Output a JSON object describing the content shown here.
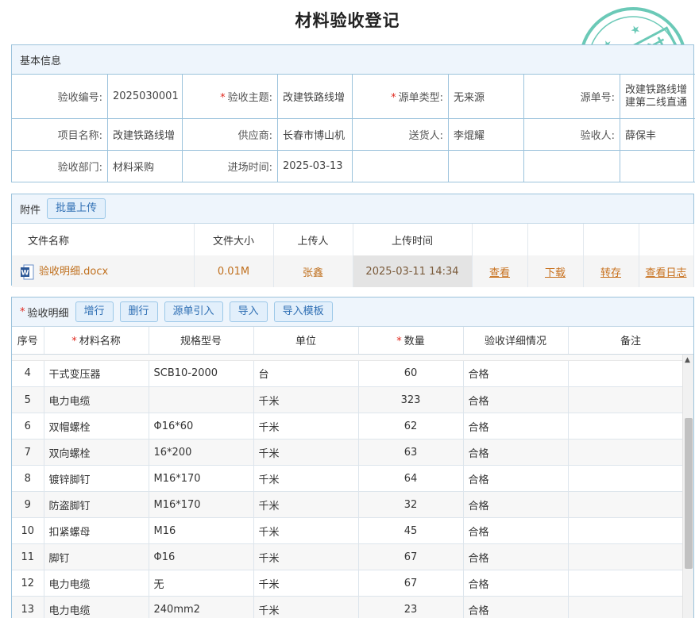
{
  "title": "材料验收登记",
  "stamp_text": "审核通过",
  "colors": {
    "accent": "#2f6fb4",
    "border": "#9cc3dc",
    "link": "#c8701c",
    "required": "#e0281e",
    "stamp": "#3ab8a0"
  },
  "basic": {
    "header": "基本信息",
    "fields": {
      "receipt_no": {
        "label": "验收编号:",
        "value": "2025030001"
      },
      "subject": {
        "label": "验收主题:",
        "value": "改建铁路线增"
      },
      "source_type": {
        "label": "源单类型:",
        "value": "无来源"
      },
      "source_no": {
        "label": "源单号:",
        "value": "改建铁路线增建第二线直通"
      },
      "project": {
        "label": "项目名称:",
        "value": "改建铁路线增"
      },
      "supplier": {
        "label": "供应商:",
        "value": "长春市博山机"
      },
      "deliverer": {
        "label": "送货人:",
        "value": "李焜耀"
      },
      "inspector": {
        "label": "验收人:",
        "value": "薛保丰"
      },
      "department": {
        "label": "验收部门:",
        "value": "材料采购"
      },
      "entry_time": {
        "label": "进场时间:",
        "value": "2025-03-13"
      }
    }
  },
  "attachments": {
    "header": "附件",
    "upload_button": "批量上传",
    "columns": {
      "name": "文件名称",
      "size": "文件大小",
      "uploader": "上传人",
      "time": "上传时间"
    },
    "file": {
      "name": "验收明细.docx",
      "size": "0.01M",
      "uploader": "张鑫",
      "time": "2025-03-11 14:34",
      "icon": "word-file-icon",
      "actions": {
        "view": "查看",
        "download": "下载",
        "save": "转存",
        "log": "查看日志"
      }
    }
  },
  "details": {
    "header": "验收明细",
    "buttons": {
      "add_row": "增行",
      "delete_row": "删行",
      "import_source": "源单引入",
      "import": "导入",
      "import_template": "导入模板"
    },
    "columns": {
      "seq": "序号",
      "material": "材料名称",
      "spec": "规格型号",
      "unit": "单位",
      "qty": "数量",
      "detail": "验收详细情况",
      "remark": "备注"
    },
    "rows": [
      {
        "seq": "4",
        "material": "干式变压器",
        "spec": "SCB10-2000",
        "unit": "台",
        "qty": "60",
        "detail": "合格",
        "remark": ""
      },
      {
        "seq": "5",
        "material": "电力电缆",
        "spec": "",
        "unit": "千米",
        "qty": "323",
        "detail": "合格",
        "remark": ""
      },
      {
        "seq": "6",
        "material": "双帽螺栓",
        "spec": "Φ16*60",
        "unit": "千米",
        "qty": "62",
        "detail": "合格",
        "remark": ""
      },
      {
        "seq": "7",
        "material": "双向螺栓",
        "spec": "16*200",
        "unit": "千米",
        "qty": "63",
        "detail": "合格",
        "remark": ""
      },
      {
        "seq": "8",
        "material": "镀锌脚钉",
        "spec": "M16*170",
        "unit": "千米",
        "qty": "64",
        "detail": "合格",
        "remark": ""
      },
      {
        "seq": "9",
        "material": "防盗脚钉",
        "spec": "M16*170",
        "unit": "千米",
        "qty": "32",
        "detail": "合格",
        "remark": ""
      },
      {
        "seq": "10",
        "material": "扣紧螺母",
        "spec": "M16",
        "unit": "千米",
        "qty": "45",
        "detail": "合格",
        "remark": ""
      },
      {
        "seq": "11",
        "material": "脚钉",
        "spec": "Φ16",
        "unit": "千米",
        "qty": "67",
        "detail": "合格",
        "remark": ""
      },
      {
        "seq": "12",
        "material": "电力电缆",
        "spec": "无",
        "unit": "千米",
        "qty": "67",
        "detail": "合格",
        "remark": ""
      },
      {
        "seq": "13",
        "material": "电力电缆",
        "spec": "240mm2",
        "unit": "千米",
        "qty": "23",
        "detail": "合格",
        "remark": ""
      }
    ]
  }
}
